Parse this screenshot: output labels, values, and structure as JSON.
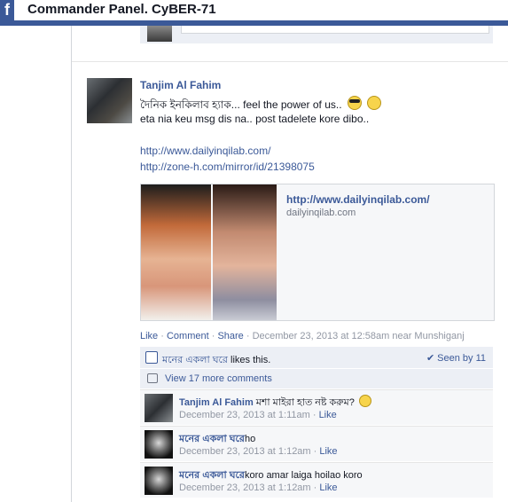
{
  "window": {
    "title": "Commander Panel. CyBER-71",
    "logo": "f"
  },
  "post": {
    "author": "Tanjim Al Fahim",
    "line1": "দৈনিক ইনকিলাব হ্যাক... feel the power of us..",
    "line2": "eta nia keu msg dis na.. post tadelete kore dibo..",
    "link1": "http://www.dailyinqilab.com/",
    "link2": "http://zone-h.com/mirror/id/21398075",
    "preview": {
      "url": "http://www.dailyinqilab.com/",
      "domain": "dailyinqilab.com"
    },
    "actions": {
      "like": "Like",
      "comment": "Comment",
      "share": "Share",
      "meta": "December 23, 2013 at 12:58am near Munshiganj",
      "sep": " · "
    }
  },
  "ufi": {
    "liker": "মনের একলা ঘরে",
    "likes_suffix": " likes this.",
    "seen_by": "Seen by 11",
    "view_more": "View 17 more comments"
  },
  "comments": [
    {
      "name": "Tanjim Al Fahim",
      "text": "মশা মাইরা হাত নষ্ট করুম?",
      "time": "December 23, 2013 at 1:11am",
      "like": "Like"
    },
    {
      "name": "মনের একলা ঘরে",
      "text": "ho",
      "time": "December 23, 2013 at 1:12am",
      "like": "Like"
    },
    {
      "name": "মনের একলা ঘরে",
      "text": "koro amar laiga hoilao koro",
      "time": "December 23, 2013 at 1:12am",
      "like": "Like"
    }
  ],
  "icons": [
    "facebook-logo-icon",
    "cool-emoji-icon",
    "smile-emoji-icon",
    "like-thumb-icon",
    "checkmark-icon",
    "comment-bubble-icon",
    "sad-emoji-icon"
  ],
  "colors": {
    "brand": "#3b5998",
    "meta": "#9197a3",
    "ufi_bg": "#eceff5"
  }
}
